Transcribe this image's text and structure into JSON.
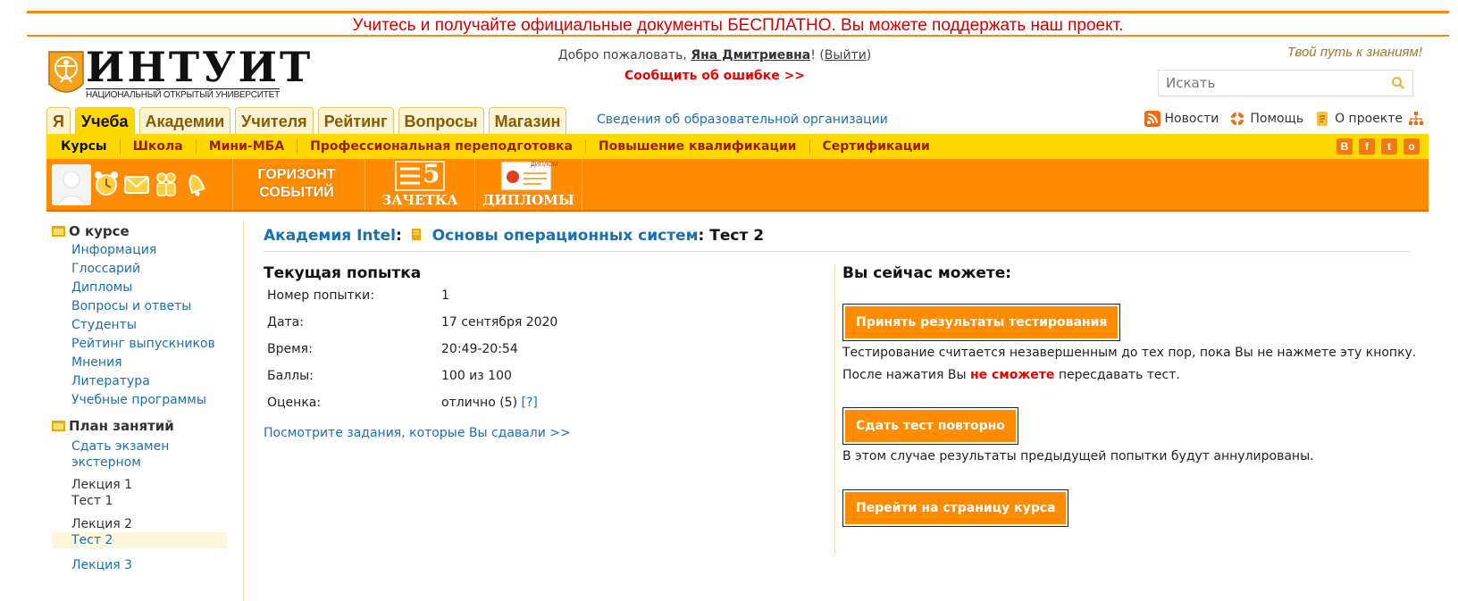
{
  "banner": {
    "text": "Учитесь и получайте официальные документы БЕСПЛАТНО. Вы можете поддержать наш проект."
  },
  "logo": {
    "word": "ИНТУИТ",
    "subtitle": "НАЦИОНАЛЬНЫЙ ОТКРЫТЫЙ УНИВЕРСИТЕТ"
  },
  "header": {
    "welcome_prefix": "Добро пожаловать, ",
    "user_name": "Яна Дмитриевна",
    "welcome_bang": "! (",
    "logout": "Выйти",
    "welcome_suffix": ")",
    "report_error": "Сообщить об ошибке >>",
    "slogan": "Твой путь к знаниям!",
    "search_placeholder": "Искать"
  },
  "tabs": [
    {
      "label": "Я"
    },
    {
      "label": "Учеба",
      "active": true
    },
    {
      "label": "Академии"
    },
    {
      "label": "Учителя"
    },
    {
      "label": "Рейтинг"
    },
    {
      "label": "Вопросы"
    },
    {
      "label": "Магазин"
    }
  ],
  "org_link": "Сведения об образовательной организации",
  "toplinks": {
    "news": "Новости",
    "help": "Помощь",
    "about": "О проекте"
  },
  "subnav": [
    "Курсы",
    "Школа",
    "Мини-МБА",
    "Профессиональная переподготовка",
    "Повышение квалификации",
    "Сертификации"
  ],
  "social": [
    "В",
    "f",
    "t",
    "о"
  ],
  "orangebar": {
    "horizon_line1": "ГОРИЗОНТ",
    "horizon_line2": "СОБЫТИЙ",
    "grade": "5",
    "zachetka": "ЗАЧЕТКА",
    "diplomas": "ДИПЛОМЫ",
    "diploma_badge": "ДИПЛОМ"
  },
  "sidebar": {
    "about_heading": "О курсе",
    "about_links": [
      "Информация",
      "Глоссарий",
      "Дипломы",
      "Вопросы и ответы",
      "Студенты",
      "Рейтинг выпускников",
      "Мнения",
      "Литература",
      "Учебные программы"
    ],
    "plan_heading": "План занятий",
    "exam_line1": "Сдать экзамен",
    "exam_line2": "экстерном",
    "lecture1": "Лекция 1",
    "test1": "Тест 1",
    "lecture2": "Лекция 2",
    "test2": "Тест 2",
    "lecture3": "Лекция 3"
  },
  "breadcrumb": {
    "academy": "Академия Intel",
    "course": "Основы операционных систем",
    "test": "Тест 2"
  },
  "attempt": {
    "heading": "Текущая попытка",
    "rows": [
      {
        "key": "Номер попытки:",
        "value": "1"
      },
      {
        "key": "Дата:",
        "value": "17 сентября 2020"
      },
      {
        "key": "Время:",
        "value": "20:49-20:54"
      },
      {
        "key": "Баллы:",
        "value": "100 из 100"
      },
      {
        "key": "Оценка:",
        "value": "отлично (5)"
      }
    ],
    "help_link": "[?]",
    "view_tasks": "Посмотрите задания, которые Вы сдавали >>"
  },
  "actions": {
    "heading": "Вы сейчас можете:",
    "accept_button": "Принять результаты тестирования",
    "accept_note1": "Тестирование считается незавершенным до тех пор, пока Вы не нажмете эту кнопку.",
    "accept_note2_prefix": "После нажатия Вы ",
    "accept_note2_red": "не сможете",
    "accept_note2_suffix": " пересдавать тест.",
    "retry_button": "Сдать тест повторно",
    "retry_note": "В этом случае результаты предыдущей попытки будут аннулированы.",
    "course_button": "Перейти на страницу курса"
  },
  "colors": {
    "accent_orange": "#ff8c00",
    "yellow": "#ffd800",
    "link": "#1a6fb0",
    "alert_red": "#e00000"
  }
}
